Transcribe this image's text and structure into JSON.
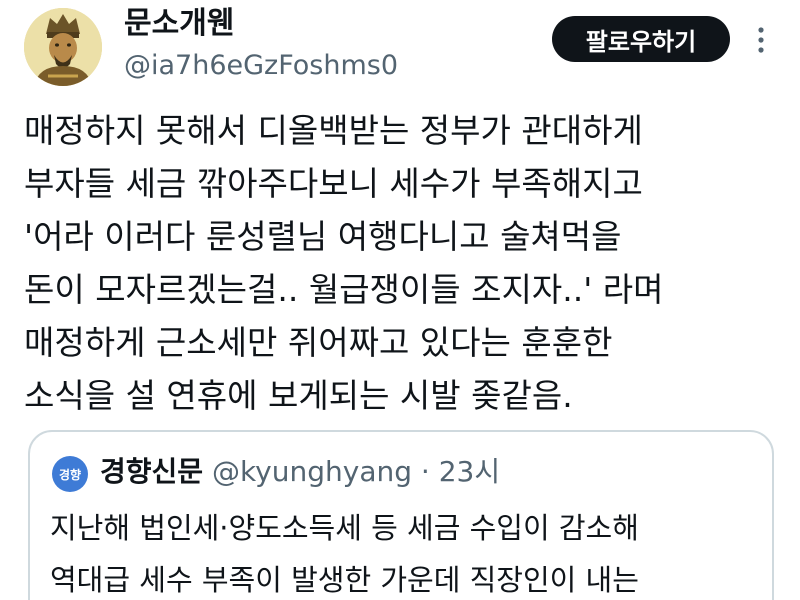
{
  "author": {
    "display_name": "문소개웬",
    "handle": "@ia7h6eGzFoshms0"
  },
  "follow_label": "팔로우하기",
  "tweet": {
    "lines": [
      "매정하지 못해서 디올백받는 정부가 관대하게",
      "부자들 세금 깎아주다보니 세수가 부족해지고",
      "'어라 이러다 룬성렬님 여행다니고 술쳐먹을",
      "돈이 모자르겠는걸.. 월급쟁이들 조지자..' 라며",
      "매정하게 근소세만 쥐어짜고 있다는 훈훈한",
      "소식을 설 연휴에 보게되는 시발 좆같음."
    ]
  },
  "quote": {
    "avatar_label": "경향",
    "name": "경향신문",
    "handle": "@kyunghyang",
    "separator": "·",
    "time": "23시",
    "lines": [
      "지난해 법인세·양도소득세 등 세금 수입이 감소해",
      "역대급 세수 부족이 발생한 가운데 직장인이 내는"
    ]
  },
  "colors": {
    "text": "#0f1419",
    "secondary": "#536471",
    "border": "#cfd9de",
    "button_bg": "#0f1419",
    "button_text": "#ffffff"
  },
  "icons": {
    "more": "more-vertical-icon",
    "avatar": "avatar-portrait"
  }
}
